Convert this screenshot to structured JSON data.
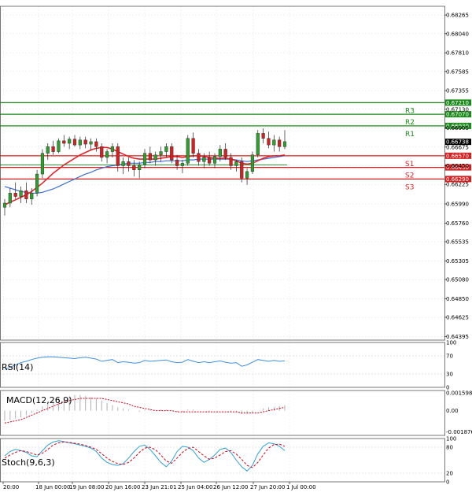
{
  "colors": {
    "bull": "#2e9e2e",
    "bear": "#d32020",
    "resistance": "#1a8a1a",
    "support": "#d81f1f",
    "ma_fast": "#e8232a",
    "ma_slow": "#3b6fd8",
    "rsi": "#3f8fe0",
    "macd_hist": "#b0b0b0",
    "macd_signal": "#d0021b",
    "stoch_k": "#2fa2d6",
    "stoch_d": "#d0021b",
    "grid": "#e6e6e6",
    "current_box": "#000000"
  },
  "chart_data": [
    {
      "type": "candlestick",
      "name": "price",
      "ylim": [
        0.6435,
        0.6837
      ],
      "y_ticks": [
        "0.68265",
        "0.68040",
        "0.67810",
        "0.67585",
        "0.67355",
        "0.67130",
        "0.66905",
        "0.66675",
        "0.66450",
        "0.66225",
        "0.65990",
        "0.65760",
        "0.65535",
        "0.65305",
        "0.65080",
        "0.64850",
        "0.64625",
        "0.64395"
      ],
      "x_ticks": [
        "20:00",
        "18 Jun 00:00",
        "19 Jun 08:00",
        "20 Jun 16:00",
        "23 Jun 21:01",
        "25 Jun 04:00",
        "26 Jun 12:00",
        "27 Jun 20:00",
        "1 Jul 00:00"
      ],
      "levels": [
        {
          "label": "R3",
          "value": 0.6721,
          "value_text": "0.67210",
          "kind": "resistance"
        },
        {
          "label": "R2",
          "value": 0.6707,
          "value_text": "0.67070",
          "kind": "resistance"
        },
        {
          "label": "R1",
          "value": 0.6693,
          "value_text": "0.66930",
          "kind": "resistance"
        },
        {
          "label": "S1",
          "value": 0.6657,
          "value_text": "0.66570",
          "kind": "support"
        },
        {
          "label": "S2",
          "value": 0.6643,
          "value_text": "0.66430",
          "kind": "support"
        },
        {
          "label": "S3",
          "value": 0.6629,
          "value_text": "0.66290",
          "kind": "support"
        }
      ],
      "current_price": {
        "value": 0.66738,
        "text": "0.66738"
      },
      "candles": [
        [
          0.6595,
          0.6605,
          0.6585,
          0.66
        ],
        [
          0.66,
          0.6618,
          0.6595,
          0.6612
        ],
        [
          0.6612,
          0.6625,
          0.6605,
          0.6608
        ],
        [
          0.6608,
          0.662,
          0.66,
          0.6615
        ],
        [
          0.6615,
          0.6625,
          0.66,
          0.6605
        ],
        [
          0.6605,
          0.6618,
          0.6598,
          0.6612
        ],
        [
          0.6612,
          0.664,
          0.6608,
          0.6635
        ],
        [
          0.6635,
          0.6665,
          0.663,
          0.666
        ],
        [
          0.666,
          0.6672,
          0.6652,
          0.6668
        ],
        [
          0.6668,
          0.6675,
          0.6658,
          0.6662
        ],
        [
          0.6662,
          0.6678,
          0.666,
          0.6675
        ],
        [
          0.6675,
          0.6682,
          0.6668,
          0.6672
        ],
        [
          0.6672,
          0.668,
          0.6665,
          0.6677
        ],
        [
          0.6677,
          0.6682,
          0.6668,
          0.667
        ],
        [
          0.667,
          0.668,
          0.6665,
          0.6676
        ],
        [
          0.6676,
          0.668,
          0.6666,
          0.6671
        ],
        [
          0.6671,
          0.6678,
          0.6664,
          0.6674
        ],
        [
          0.6674,
          0.6678,
          0.6662,
          0.6668
        ],
        [
          0.6668,
          0.6672,
          0.665,
          0.6655
        ],
        [
          0.6655,
          0.6665,
          0.6648,
          0.6662
        ],
        [
          0.6662,
          0.6672,
          0.6655,
          0.6668
        ],
        [
          0.6668,
          0.6672,
          0.6638,
          0.6645
        ],
        [
          0.6645,
          0.6655,
          0.6635,
          0.665
        ],
        [
          0.665,
          0.6655,
          0.6638,
          0.6645
        ],
        [
          0.6645,
          0.6652,
          0.6632,
          0.664
        ],
        [
          0.664,
          0.665,
          0.663,
          0.6646
        ],
        [
          0.6646,
          0.6665,
          0.6642,
          0.666
        ],
        [
          0.666,
          0.6668,
          0.6648,
          0.6652
        ],
        [
          0.6652,
          0.6662,
          0.6645,
          0.6658
        ],
        [
          0.6658,
          0.6668,
          0.665,
          0.6662
        ],
        [
          0.6662,
          0.6672,
          0.6655,
          0.6668
        ],
        [
          0.6668,
          0.6672,
          0.6648,
          0.6652
        ],
        [
          0.6652,
          0.6658,
          0.664,
          0.6645
        ],
        [
          0.6645,
          0.6652,
          0.6636,
          0.6648
        ],
        [
          0.6648,
          0.6682,
          0.6645,
          0.6678
        ],
        [
          0.6678,
          0.6685,
          0.6655,
          0.666
        ],
        [
          0.666,
          0.6665,
          0.6645,
          0.665
        ],
        [
          0.665,
          0.666,
          0.6642,
          0.6655
        ],
        [
          0.6655,
          0.6662,
          0.6645,
          0.6648
        ],
        [
          0.6648,
          0.666,
          0.6642,
          0.6656
        ],
        [
          0.6656,
          0.667,
          0.665,
          0.6665
        ],
        [
          0.6665,
          0.6672,
          0.6652,
          0.6655
        ],
        [
          0.6655,
          0.666,
          0.664,
          0.6645
        ],
        [
          0.6645,
          0.6652,
          0.6638,
          0.665
        ],
        [
          0.665,
          0.6655,
          0.6625,
          0.663
        ],
        [
          0.663,
          0.6642,
          0.6622,
          0.6638
        ],
        [
          0.6638,
          0.6662,
          0.6635,
          0.6658
        ],
        [
          0.6658,
          0.6688,
          0.6655,
          0.6684
        ],
        [
          0.6684,
          0.669,
          0.6672,
          0.6678
        ],
        [
          0.6678,
          0.6686,
          0.6666,
          0.667
        ],
        [
          0.667,
          0.6682,
          0.6662,
          0.6676
        ],
        [
          0.6676,
          0.668,
          0.6662,
          0.6668
        ],
        [
          0.6668,
          0.6688,
          0.6665,
          0.6674
        ]
      ],
      "ma_fast": [
        0.6598,
        0.6601,
        0.6604,
        0.6607,
        0.661,
        0.6614,
        0.6619,
        0.6624,
        0.663,
        0.6636,
        0.6641,
        0.6646,
        0.665,
        0.6654,
        0.6658,
        0.6661,
        0.6664,
        0.6666,
        0.6667,
        0.6667,
        0.6665,
        0.6662,
        0.6659,
        0.6656,
        0.6654,
        0.6653,
        0.6653,
        0.6653,
        0.6653,
        0.6654,
        0.6655,
        0.6656,
        0.6656,
        0.6655,
        0.6656,
        0.6657,
        0.6657,
        0.6656,
        0.6655,
        0.6654,
        0.6654,
        0.6654,
        0.6653,
        0.6651,
        0.6648,
        0.6647,
        0.6648,
        0.6651,
        0.6654,
        0.6656,
        0.6657,
        0.6657,
        0.6658
      ],
      "ma_slow": [
        0.662,
        0.6618,
        0.6616,
        0.6614,
        0.6613,
        0.6612,
        0.6612,
        0.6613,
        0.6615,
        0.6617,
        0.662,
        0.6623,
        0.6626,
        0.6629,
        0.6632,
        0.6635,
        0.6637,
        0.664,
        0.6642,
        0.6644,
        0.6645,
        0.6646,
        0.6647,
        0.6648,
        0.6648,
        0.6648,
        0.6649,
        0.6649,
        0.665,
        0.665,
        0.6651,
        0.6651,
        0.6651,
        0.6651,
        0.6652,
        0.6652,
        0.6653,
        0.6653,
        0.6653,
        0.6653,
        0.6653,
        0.6653,
        0.6653,
        0.6652,
        0.6651,
        0.665,
        0.6651,
        0.6652,
        0.6653,
        0.6654,
        0.6655,
        0.6656,
        0.6657
      ]
    },
    {
      "type": "line",
      "name": "rsi",
      "title": "RSI(14)",
      "ylim": [
        0,
        100
      ],
      "y_ticks": [
        "100",
        "70",
        "30",
        "0"
      ],
      "values": [
        40,
        45,
        50,
        55,
        58,
        62,
        65,
        67,
        68,
        68,
        67,
        66,
        65,
        64,
        66,
        67,
        65,
        63,
        58,
        60,
        62,
        55,
        57,
        56,
        54,
        55,
        60,
        58,
        59,
        60,
        61,
        57,
        55,
        56,
        62,
        58,
        55,
        57,
        55,
        57,
        59,
        56,
        54,
        55,
        47,
        50,
        56,
        62,
        60,
        58,
        60,
        58,
        59
      ]
    },
    {
      "type": "bar",
      "name": "macd",
      "title": "MACD(12,26,9)",
      "ylim": [
        -0.0022,
        0.0018
      ],
      "y_ticks": [
        "0.001598",
        "0.00",
        "-0.001876"
      ],
      "histogram": [
        -0.0009,
        -0.0008,
        -0.0007,
        -0.0006,
        -0.0004,
        -0.0002,
        0.0001,
        0.0004,
        0.0007,
        0.0009,
        0.0011,
        0.0012,
        0.0013,
        0.0014,
        0.0014,
        0.0013,
        0.0012,
        0.0011,
        0.0009,
        0.0007,
        0.0005,
        0.0003,
        0.0002,
        0.0001,
        0.0,
        -0.0001,
        0.0001,
        0.0001,
        0.0,
        0.0001,
        0.0001,
        0.0,
        -0.0001,
        -0.0001,
        0.0001,
        0.0001,
        0.0,
        0.0,
        -0.0001,
        0.0,
        0.0,
        0.0,
        -0.0001,
        -0.0001,
        -0.0003,
        -0.0003,
        -0.0002,
        0.0,
        0.0002,
        0.0003,
        0.0003,
        0.0004,
        0.0005
      ],
      "signal": [
        -0.0011,
        -0.001,
        -0.0009,
        -0.0008,
        -0.0006,
        -0.0004,
        -0.0002,
        0.0,
        0.0002,
        0.0004,
        0.0006,
        0.0008,
        0.0009,
        0.001,
        0.0011,
        0.0011,
        0.0011,
        0.0011,
        0.0011,
        0.001,
        0.0009,
        0.0008,
        0.0007,
        0.0006,
        0.0004,
        0.0003,
        0.0002,
        0.0001,
        0.0,
        0.0,
        0.0,
        0.0,
        -0.0001,
        -0.0001,
        -0.0001,
        -0.0001,
        -0.0001,
        -0.0001,
        -0.0001,
        -0.0001,
        -0.0001,
        -0.0001,
        -0.0001,
        -0.0001,
        -0.0002,
        -0.0002,
        -0.0002,
        -0.0002,
        -0.0001,
        0.0,
        0.0001,
        0.0002,
        0.0003
      ]
    },
    {
      "type": "line",
      "name": "stochastic",
      "title": "Stoch(9,6,3)",
      "ylim": [
        0,
        100
      ],
      "y_ticks": [
        "100",
        "80",
        "20",
        "0"
      ],
      "k": [
        60,
        70,
        75,
        72,
        68,
        60,
        58,
        72,
        85,
        92,
        95,
        93,
        90,
        88,
        85,
        82,
        78,
        70,
        55,
        45,
        40,
        38,
        42,
        55,
        70,
        82,
        85,
        75,
        60,
        45,
        35,
        48,
        70,
        82,
        80,
        72,
        55,
        45,
        52,
        62,
        75,
        78,
        68,
        50,
        35,
        25,
        38,
        65,
        82,
        90,
        88,
        82,
        72
      ],
      "d": [
        55,
        62,
        68,
        72,
        70,
        66,
        62,
        66,
        75,
        85,
        90,
        92,
        91,
        89,
        87,
        84,
        80,
        75,
        65,
        55,
        47,
        42,
        40,
        45,
        55,
        68,
        78,
        80,
        74,
        62,
        48,
        43,
        55,
        68,
        77,
        80,
        70,
        60,
        52,
        55,
        62,
        70,
        72,
        64,
        52,
        38,
        33,
        45,
        62,
        78,
        86,
        87,
        82
      ]
    }
  ]
}
